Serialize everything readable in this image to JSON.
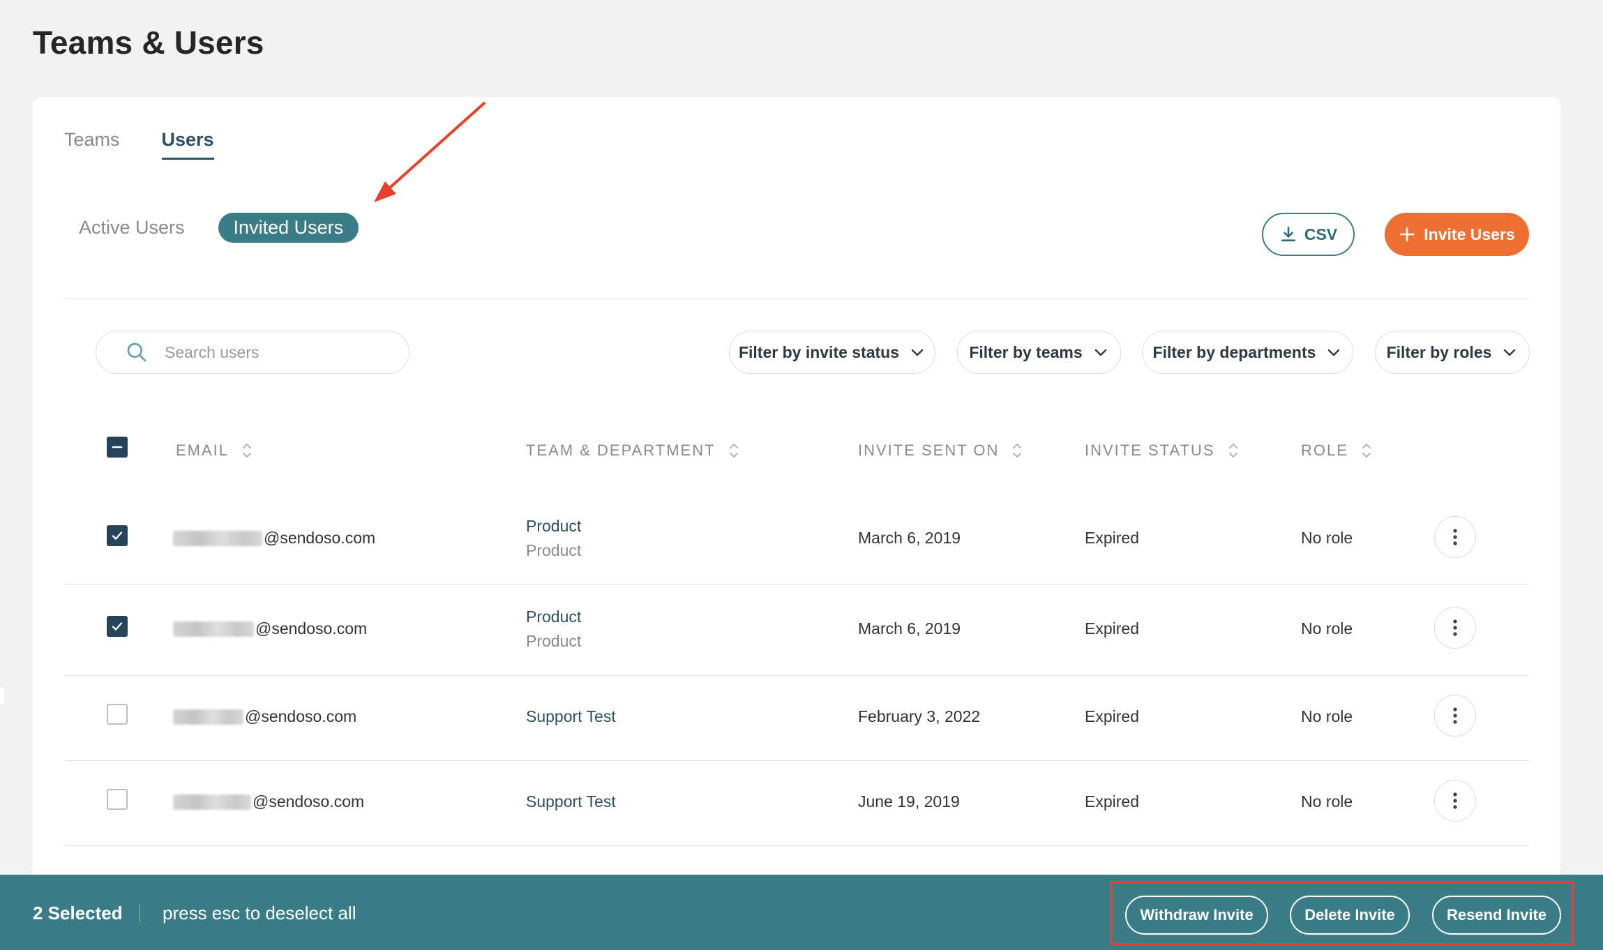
{
  "page": {
    "title": "Teams & Users"
  },
  "tabs": [
    {
      "label": "Teams",
      "active": false
    },
    {
      "label": "Users",
      "active": true
    }
  ],
  "subtabs": [
    {
      "label": "Active Users",
      "active": false
    },
    {
      "label": "Invited Users",
      "active": true
    }
  ],
  "actions": {
    "csv_label": "CSV",
    "invite_label": "Invite Users"
  },
  "search": {
    "placeholder": "Search users",
    "value": ""
  },
  "filters": [
    {
      "label": "Filter by invite status"
    },
    {
      "label": "Filter by teams"
    },
    {
      "label": "Filter by departments"
    },
    {
      "label": "Filter by roles"
    }
  ],
  "table": {
    "columns": [
      "EMAIL",
      "TEAM & DEPARTMENT",
      "INVITE SENT ON",
      "INVITE STATUS",
      "ROLE"
    ],
    "rows": [
      {
        "checked": true,
        "email_domain": "@sendoso.com",
        "team": "Product",
        "department": "Product",
        "sent_on": "March 6, 2019",
        "status": "Expired",
        "role": "No role"
      },
      {
        "checked": true,
        "email_domain": "@sendoso.com",
        "team": "Product",
        "department": "Product",
        "sent_on": "March 6, 2019",
        "status": "Expired",
        "role": "No role"
      },
      {
        "checked": false,
        "email_domain": "@sendoso.com",
        "team": "Support Test",
        "department": "",
        "sent_on": "February 3, 2022",
        "status": "Expired",
        "role": "No role"
      },
      {
        "checked": false,
        "email_domain": "@sendoso.com",
        "team": "Support Test",
        "department": "",
        "sent_on": "June 19, 2019",
        "status": "Expired",
        "role": "No role"
      }
    ]
  },
  "selection_bar": {
    "count_label": "2 Selected",
    "hint": "press esc to deselect all",
    "buttons": [
      "Withdraw Invite",
      "Delete Invite",
      "Resend Invite"
    ]
  },
  "icons": {
    "search": "search-icon",
    "download": "download-icon",
    "plus": "plus-icon",
    "chevron": "chevron-down-icon",
    "sort": "sort-icon",
    "kebab": "more-vertical-icon"
  },
  "colors": {
    "primary": "#3b7d86",
    "accent": "#ef6f33",
    "navy": "#25445a",
    "annotation": "#e8402a"
  }
}
